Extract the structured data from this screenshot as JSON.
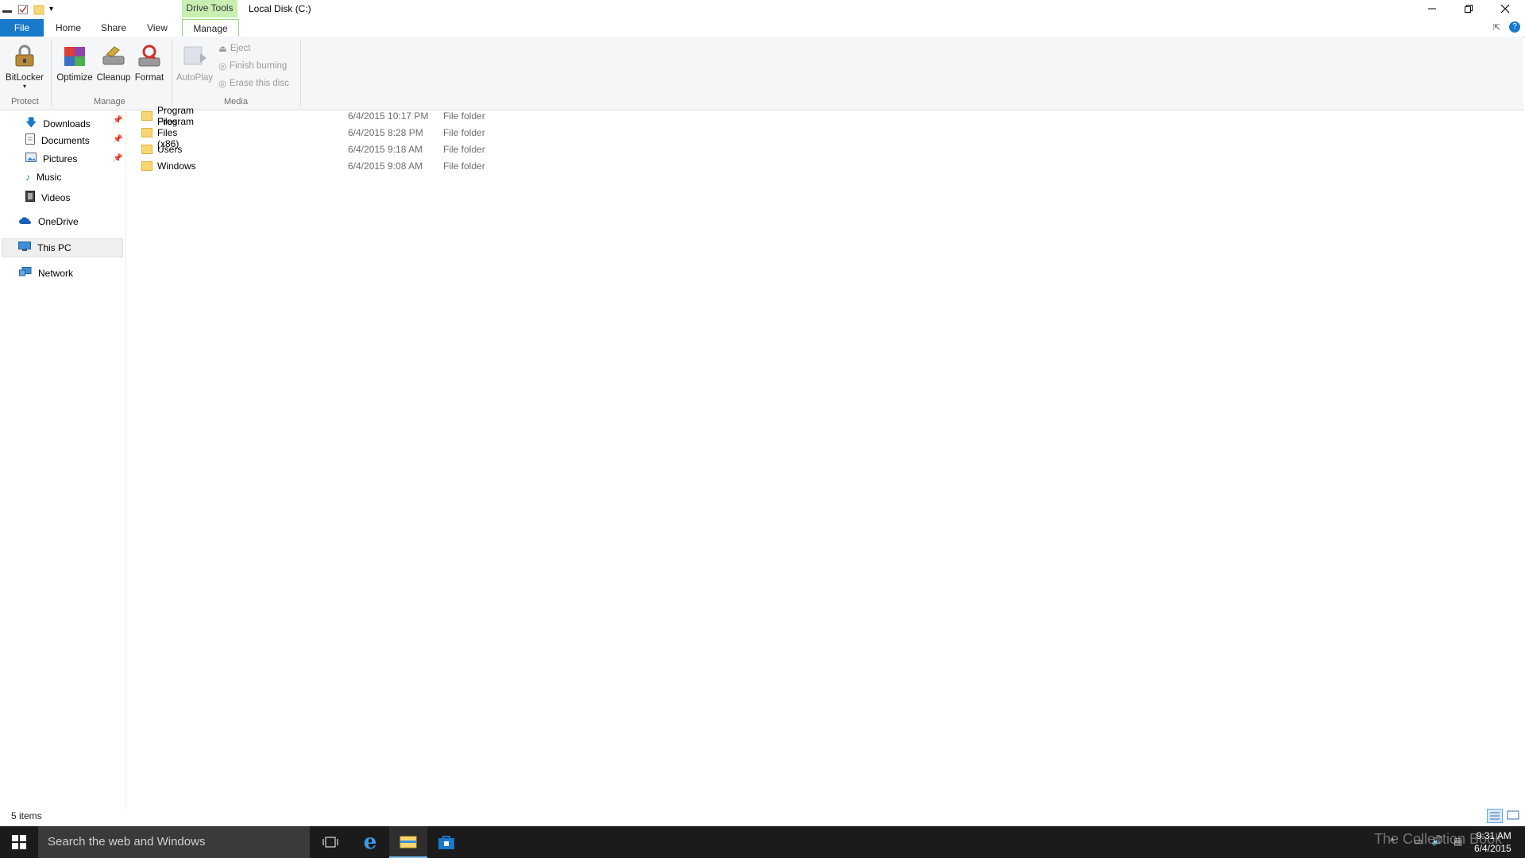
{
  "window": {
    "context_tab": "Drive Tools",
    "title": "Local Disk (C:)"
  },
  "ribbon": {
    "tabs": [
      "File",
      "Home",
      "Share",
      "View",
      "Manage"
    ],
    "protect": {
      "bitlocker": "BitLocker",
      "label": "Protect"
    },
    "manage": {
      "optimize": "Optimize",
      "cleanup": "Cleanup",
      "format": "Format",
      "label": "Manage"
    },
    "media": {
      "autoplay": "AutoPlay",
      "eject": "Eject",
      "finish_burning": "Finish burning",
      "erase": "Erase this disc",
      "label": "Media"
    }
  },
  "nav": {
    "downloads": "Downloads",
    "documents": "Documents",
    "pictures": "Pictures",
    "music": "Music",
    "videos": "Videos",
    "onedrive": "OneDrive",
    "thispc": "This PC",
    "network": "Network"
  },
  "files": [
    {
      "name": "Program Files",
      "date": "6/4/2015 10:17 PM",
      "type": "File folder"
    },
    {
      "name": "Program Files (x86)",
      "date": "6/4/2015 8:28 PM",
      "type": "File folder"
    },
    {
      "name": "Users",
      "date": "6/4/2015 9:18 AM",
      "type": "File folder"
    },
    {
      "name": "Windows",
      "date": "6/4/2015 9:08 AM",
      "type": "File folder"
    }
  ],
  "status": {
    "items": "5 items"
  },
  "taskbar": {
    "search_placeholder": "Search the web and Windows",
    "time": "9:31 AM",
    "date": "6/4/2015",
    "watermark": "The Collection Book"
  },
  "colors": {
    "accent": "#1979ca",
    "context_tab": "#c6efb1",
    "taskbar": "#1b1b1b"
  }
}
